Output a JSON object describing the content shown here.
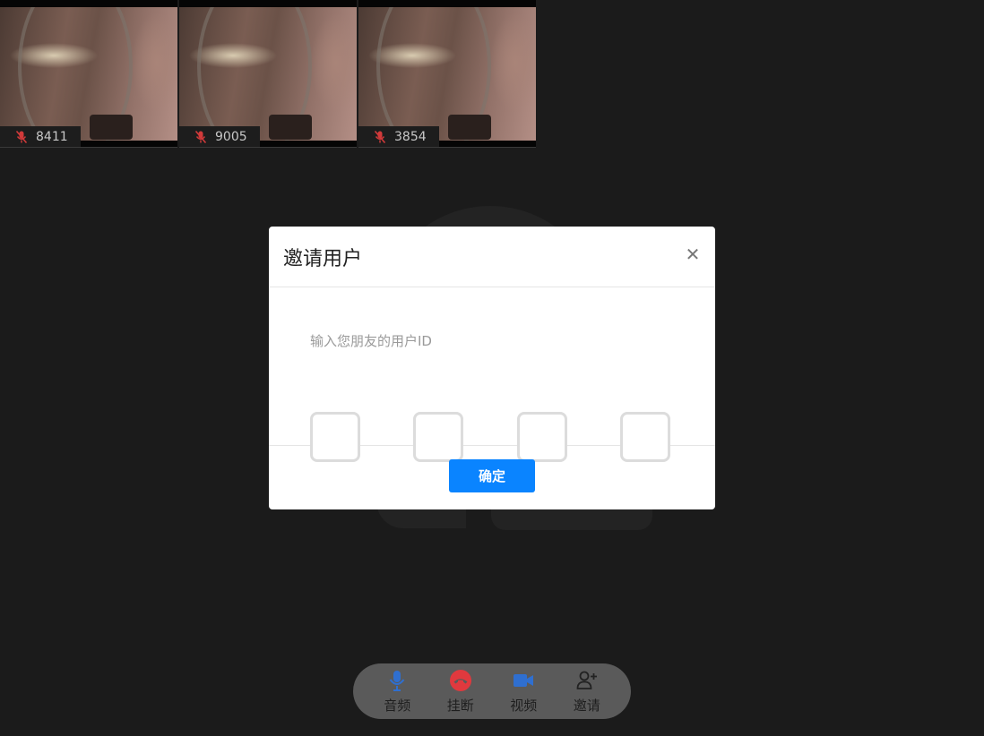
{
  "participants": [
    {
      "id": "8411",
      "muted": true
    },
    {
      "id": "9005",
      "muted": true
    },
    {
      "id": "3854",
      "muted": true
    }
  ],
  "modal": {
    "title": "邀请用户",
    "close_icon": "close-icon",
    "hint": "输入您朋友的用户ID",
    "code_digits": [
      "",
      "",
      "",
      ""
    ],
    "confirm_label": "确定"
  },
  "controls": {
    "audio": {
      "label": "音频",
      "icon": "microphone-icon",
      "color": "#2f6fd0"
    },
    "hangup": {
      "label": "挂断",
      "icon": "hangup-icon",
      "color": "#e0393e"
    },
    "video": {
      "label": "视频",
      "icon": "video-camera-icon",
      "color": "#2f6fd0"
    },
    "invite": {
      "label": "邀请",
      "icon": "add-user-icon",
      "color": "#222222"
    }
  },
  "colors": {
    "background": "#1b1b1b",
    "primary": "#0a84ff",
    "muted_icon": "#d13a3a"
  }
}
